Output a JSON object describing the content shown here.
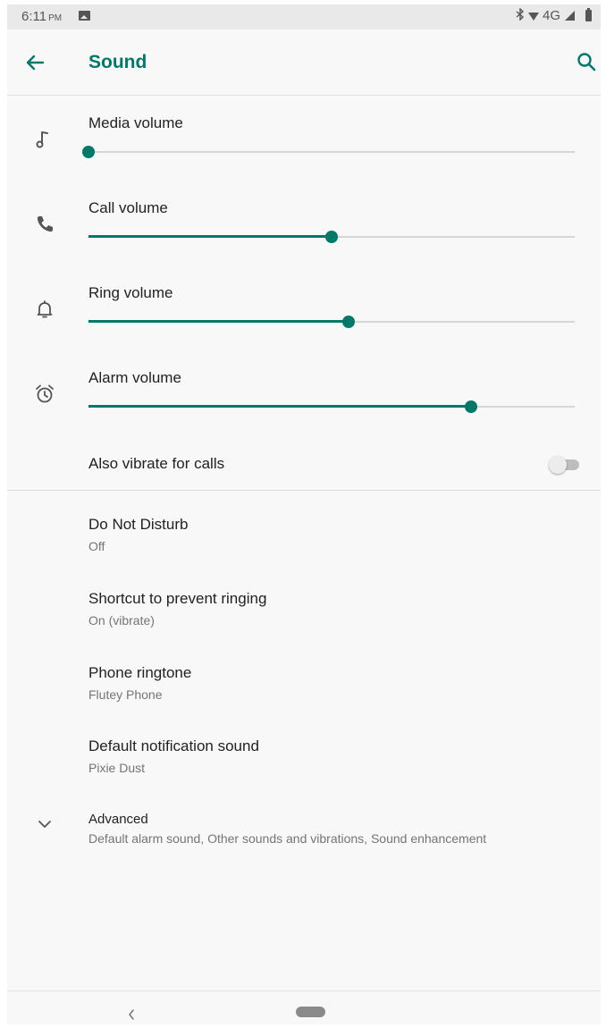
{
  "status_bar": {
    "time": "6:11",
    "ampm": "PM",
    "network": "4G",
    "icons": [
      "image-icon",
      "bluetooth-icon",
      "wifi-icon",
      "signal-icon",
      "battery-icon"
    ]
  },
  "app_bar": {
    "title": "Sound",
    "back_icon": "arrow-left-icon",
    "search_icon": "search-icon"
  },
  "volumes": [
    {
      "label": "Media volume",
      "icon": "music-note-icon",
      "level": 0.0
    },
    {
      "label": "Call volume",
      "icon": "phone-icon",
      "level": 0.5
    },
    {
      "label": "Ring volume",
      "icon": "bell-icon",
      "level": 0.535
    },
    {
      "label": "Alarm volume",
      "icon": "alarm-clock-icon",
      "level": 0.786
    }
  ],
  "vibrate": {
    "label": "Also vibrate for calls",
    "enabled": false
  },
  "preferences": [
    {
      "title": "Do Not Disturb",
      "summary": "Off"
    },
    {
      "title": "Shortcut to prevent ringing",
      "summary": "On (vibrate)"
    },
    {
      "title": "Phone ringtone",
      "summary": "Flutey Phone"
    },
    {
      "title": "Default notification sound",
      "summary": "Pixie Dust"
    }
  ],
  "advanced": {
    "title": "Advanced",
    "summary": "Default alarm sound, Other sounds and vibrations, Sound enhancement",
    "icon": "chevron-down-icon"
  },
  "nav_bar": {
    "back_icon": "nav-back-icon",
    "home_icon": "nav-home-pill"
  },
  "colors": {
    "accent": "#00796b",
    "track": "#d6d6d6",
    "background": "#f8f8f8",
    "secondary_text": "#757575"
  }
}
